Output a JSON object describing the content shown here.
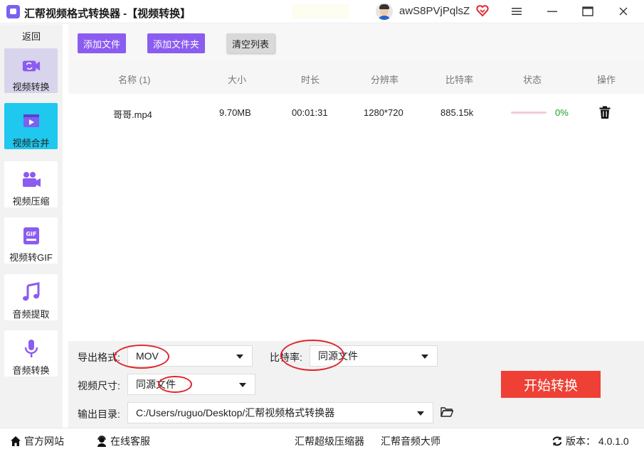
{
  "window": {
    "app_name": "汇帮视频格式转换器",
    "title_suffix": " -【视频转换】",
    "username": "awS8PVjPqlsZ",
    "menu_icon": "hamburger-icon",
    "minimize_icon": "minimize-icon",
    "maximize_icon": "maximize-icon",
    "close_icon": "close-icon"
  },
  "sidebar": {
    "back_label": "返回",
    "items": [
      {
        "label": "视频转换",
        "icon": "video-convert-icon",
        "active": true
      },
      {
        "label": "视频合并",
        "icon": "video-merge-icon"
      },
      {
        "label": "视频压缩",
        "icon": "video-compress-icon"
      },
      {
        "label": "视频转GIF",
        "icon": "gif-icon"
      },
      {
        "label": "音频提取",
        "icon": "music-note-icon"
      },
      {
        "label": "音频转换",
        "icon": "microphone-icon"
      }
    ]
  },
  "toolbar": {
    "add_file": "添加文件",
    "add_folder": "添加文件夹",
    "clear_list": "清空列表"
  },
  "table": {
    "headers": {
      "name": "名称 (1)",
      "size": "大小",
      "duration": "时长",
      "resolution": "分辨率",
      "bitrate": "比特率",
      "status": "状态",
      "action": "操作"
    },
    "rows": [
      {
        "name": "哥哥.mp4",
        "size": "9.70MB",
        "duration": "00:01:31",
        "resolution": "1280*720",
        "bitrate": "885.15k",
        "progress_percent": 0,
        "progress_text": "0%",
        "action_icon": "trash-icon"
      }
    ]
  },
  "settings": {
    "format_label": "导出格式:",
    "format_value": "MOV",
    "bitrate_label": "比特率:",
    "bitrate_value": "同源文件",
    "size_label": "视频尺寸:",
    "size_value": "同源文件",
    "output_label": "输出目录:",
    "output_value": "C:/Users/ruguo/Desktop/汇帮视频格式转换器",
    "start_button": "开始转换"
  },
  "statusbar": {
    "website": "官方网站",
    "support": "在线客服",
    "compressor": "汇帮超级压缩器",
    "audio_master": "汇帮音频大师",
    "version": "版本：  4.0.1.0"
  },
  "colors": {
    "accent_purple": "#8b5cf0",
    "start_red": "#ee4035",
    "merge_cyan": "#1ec8ee",
    "annotation_red": "#e0252c",
    "progress_green": "#19a11f"
  }
}
